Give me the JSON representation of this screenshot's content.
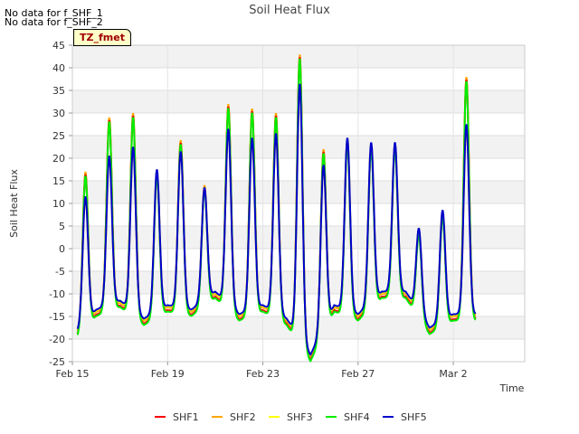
{
  "no_data_messages": [
    "No data for f_SHF_1",
    "No data for f_SHF_2"
  ],
  "tz_label": "TZ_fmet",
  "chart_data": {
    "type": "line",
    "title": "Soil Heat Flux",
    "xlabel": "Time",
    "ylabel": "Soil Heat Flux",
    "xlim": [
      "2024-02-15",
      "2024-03-05"
    ],
    "ylim": [
      -25,
      45
    ],
    "yticks": [
      -25,
      -20,
      -15,
      -10,
      -5,
      0,
      5,
      10,
      15,
      20,
      25,
      30,
      35,
      40,
      45
    ],
    "xticks": [
      {
        "date": "2024-02-15",
        "label": "Feb 15"
      },
      {
        "date": "2024-02-19",
        "label": "Feb 19"
      },
      {
        "date": "2024-02-23",
        "label": "Feb 23"
      },
      {
        "date": "2024-02-27",
        "label": "Feb 27"
      },
      {
        "date": "2024-03-02",
        "label": "Mar 2"
      }
    ],
    "grid": true,
    "legend_position": "bottom",
    "series": [
      {
        "name": "SHF1",
        "color": "#ff0000"
      },
      {
        "name": "SHF2",
        "color": "#ffa500"
      },
      {
        "name": "SHF3",
        "color": "#ffff00"
      },
      {
        "name": "SHF4",
        "color": "#00ee00"
      },
      {
        "name": "SHF5",
        "color": "#0000cc"
      }
    ],
    "daily_peaks": [
      {
        "date": "2024-02-15",
        "shf2": 17,
        "shf5": 11,
        "night_min": -20
      },
      {
        "date": "2024-02-16",
        "shf2": 29,
        "shf5": 20,
        "night_min": -14
      },
      {
        "date": "2024-02-17",
        "shf2": 30,
        "shf5": 22,
        "night_min": -12
      },
      {
        "date": "2024-02-18",
        "shf2": 17,
        "shf5": 17,
        "night_min": -16
      },
      {
        "date": "2024-02-19",
        "shf2": 24,
        "shf5": 21,
        "night_min": -13
      },
      {
        "date": "2024-02-20",
        "shf2": 14,
        "shf5": 13,
        "night_min": -14
      },
      {
        "date": "2024-02-21",
        "shf2": 32,
        "shf5": 26,
        "night_min": -10
      },
      {
        "date": "2024-02-22",
        "shf2": 31,
        "shf5": 24,
        "night_min": -15
      },
      {
        "date": "2024-02-23",
        "shf2": 30,
        "shf5": 25,
        "night_min": -13
      },
      {
        "date": "2024-02-24",
        "shf2": 43,
        "shf5": 36,
        "night_min": -16
      },
      {
        "date": "2024-02-25",
        "shf2": 22,
        "shf5": 18,
        "night_min": -24
      },
      {
        "date": "2024-02-26",
        "shf2": 24,
        "shf5": 24,
        "night_min": -13
      },
      {
        "date": "2024-02-27",
        "shf2": 23,
        "shf5": 23,
        "night_min": -15
      },
      {
        "date": "2024-02-28",
        "shf2": 23,
        "shf5": 23,
        "night_min": -10
      },
      {
        "date": "2024-02-29",
        "shf2": 4,
        "shf5": 4,
        "night_min": -10
      },
      {
        "date": "2024-03-01",
        "shf2": 8,
        "shf5": 8,
        "night_min": -18
      },
      {
        "date": "2024-03-02",
        "shf2": 38,
        "shf5": 27,
        "night_min": -15
      }
    ]
  }
}
